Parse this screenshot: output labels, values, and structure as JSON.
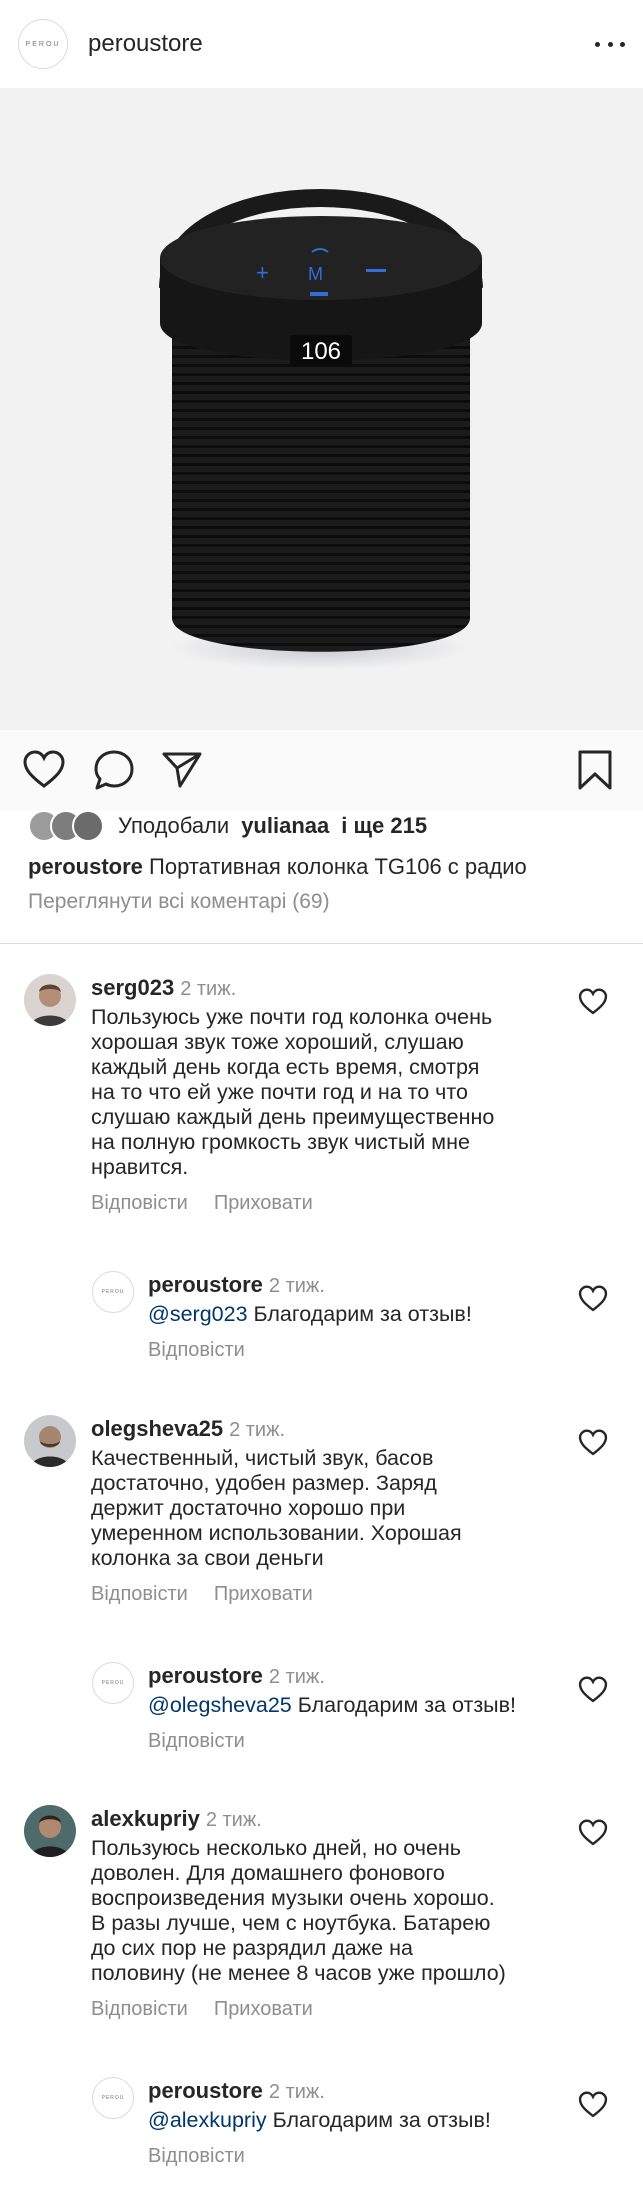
{
  "header": {
    "username": "peroustore",
    "logo_text": "PEROU"
  },
  "product": {
    "display": "106"
  },
  "likes": {
    "prefix": "Уподобали",
    "user": "yulianaa",
    "rest": "і ще 215"
  },
  "caption": {
    "user": "peroustore",
    "text": "Портативная колонка TG106 с радио"
  },
  "view_all": "Переглянути всі коментарі (69)",
  "labels": {
    "reply": "Відповісти",
    "hide": "Приховати"
  },
  "comments": [
    {
      "user": "serg023",
      "time": "2 тиж.",
      "lines": [
        "Пользуюсь уже почти год колонка очень",
        "хорошая звук тоже хороший, слушаю",
        "каждый день когда есть время, смотря",
        "на то что ей уже почти год и на то что",
        "слушаю каждый день преимущественно",
        "на полную громкость звук чистый мне",
        "нравится."
      ],
      "reply": {
        "user": "peroustore",
        "time": "2 тиж.",
        "mention": "@serg023",
        "text": "Благодарим за отзыв!"
      }
    },
    {
      "user": "olegsheva25",
      "time": "2 тиж.",
      "lines": [
        "Качественный, чистый звук, басов",
        "достаточно, удобен размер. Заряд",
        "держит достаточно хорошо при",
        "умеренном использовании. Хорошая",
        "колонка за свои деньги"
      ],
      "reply": {
        "user": "peroustore",
        "time": "2 тиж.",
        "mention": "@olegsheva25",
        "text": "Благодарим за отзыв!"
      }
    },
    {
      "user": "alexkupriy",
      "time": "2 тиж.",
      "lines": [
        "Пользуюсь несколько дней, но очень",
        "доволен. Для домашнего фонового",
        "воспроизведения музыки очень хорошо.",
        "В разы лучше, чем с ноутбука. Батарею",
        "до сих пор не разрядил даже на",
        "половину (не менее 8 часов уже прошло)"
      ],
      "reply": {
        "user": "peroustore",
        "time": "2 тиж.",
        "mention": "@alexkupriy",
        "text": "Благодарим за отзыв!"
      }
    }
  ]
}
